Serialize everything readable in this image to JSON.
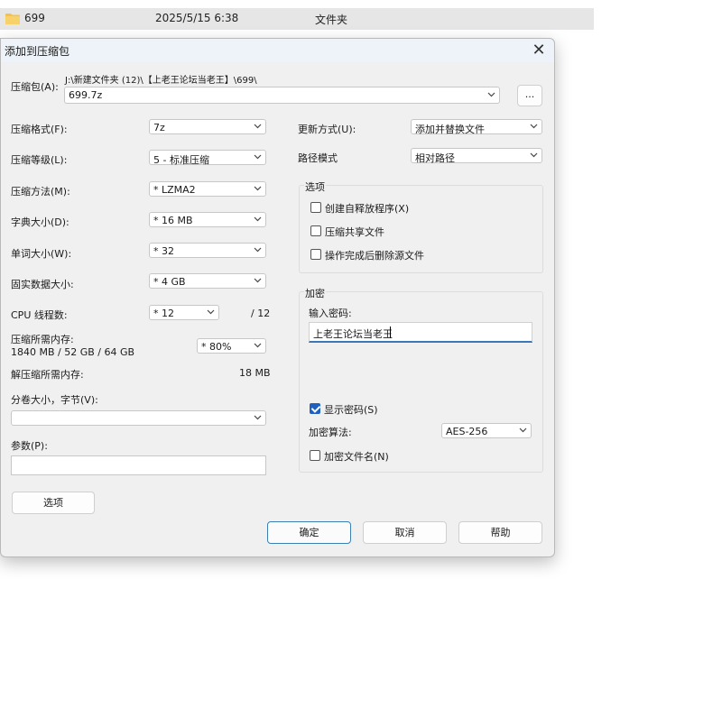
{
  "explorer": {
    "file_name": "699",
    "date": "2025/5/15 6:38",
    "type": "文件夹"
  },
  "dialog": {
    "title": "添加到压缩包",
    "archive_label": "压缩包(A):",
    "archive_path": "J:\\新建文件夹 (12)\\【上老王论坛当老王】\\699\\",
    "archive_name": "699.7z",
    "browse_label": "...",
    "left": {
      "format_label": "压缩格式(F):",
      "format_value": "7z",
      "level_label": "压缩等级(L):",
      "level_value": "5 - 标准压缩",
      "method_label": "压缩方法(M):",
      "method_value": "* LZMA2",
      "dict_label": "字典大小(D):",
      "dict_value": "* 16 MB",
      "word_label": "单词大小(W):",
      "word_value": "* 32",
      "solid_label": "固实数据大小:",
      "solid_value": "* 4 GB",
      "cpu_label": "CPU 线程数:",
      "cpu_value": "* 12",
      "cpu_total": "/ 12",
      "mem_label": "压缩所需内存:",
      "mem_detail": "1840 MB / 52 GB / 64 GB",
      "mem_value": "* 80%",
      "decomp_label": "解压缩所需内存:",
      "decomp_value": "18 MB",
      "split_label": "分卷大小，字节(V):",
      "split_value": "",
      "params_label": "参数(P):",
      "params_value": "",
      "options_button": "选项"
    },
    "right": {
      "update_label": "更新方式(U):",
      "update_value": "添加并替换文件",
      "path_label": "路径模式",
      "path_value": "相对路径",
      "options_group": "选项",
      "opt_sfx": "创建自释放程序(X)",
      "opt_shared": "压缩共享文件",
      "opt_delete": "操作完成后删除源文件",
      "encrypt_group": "加密",
      "password_label": "输入密码:",
      "password_value": "上老王论坛当老王",
      "show_password": "显示密码(S)",
      "algo_label": "加密算法:",
      "algo_value": "AES-256",
      "encrypt_names": "加密文件名(N)"
    },
    "buttons": {
      "ok": "确定",
      "cancel": "取消",
      "help": "帮助"
    },
    "colors": {
      "accent": "#1f5fbf",
      "titlebar": "#edf3f8",
      "dialog_bg": "#f0f0f0"
    }
  }
}
